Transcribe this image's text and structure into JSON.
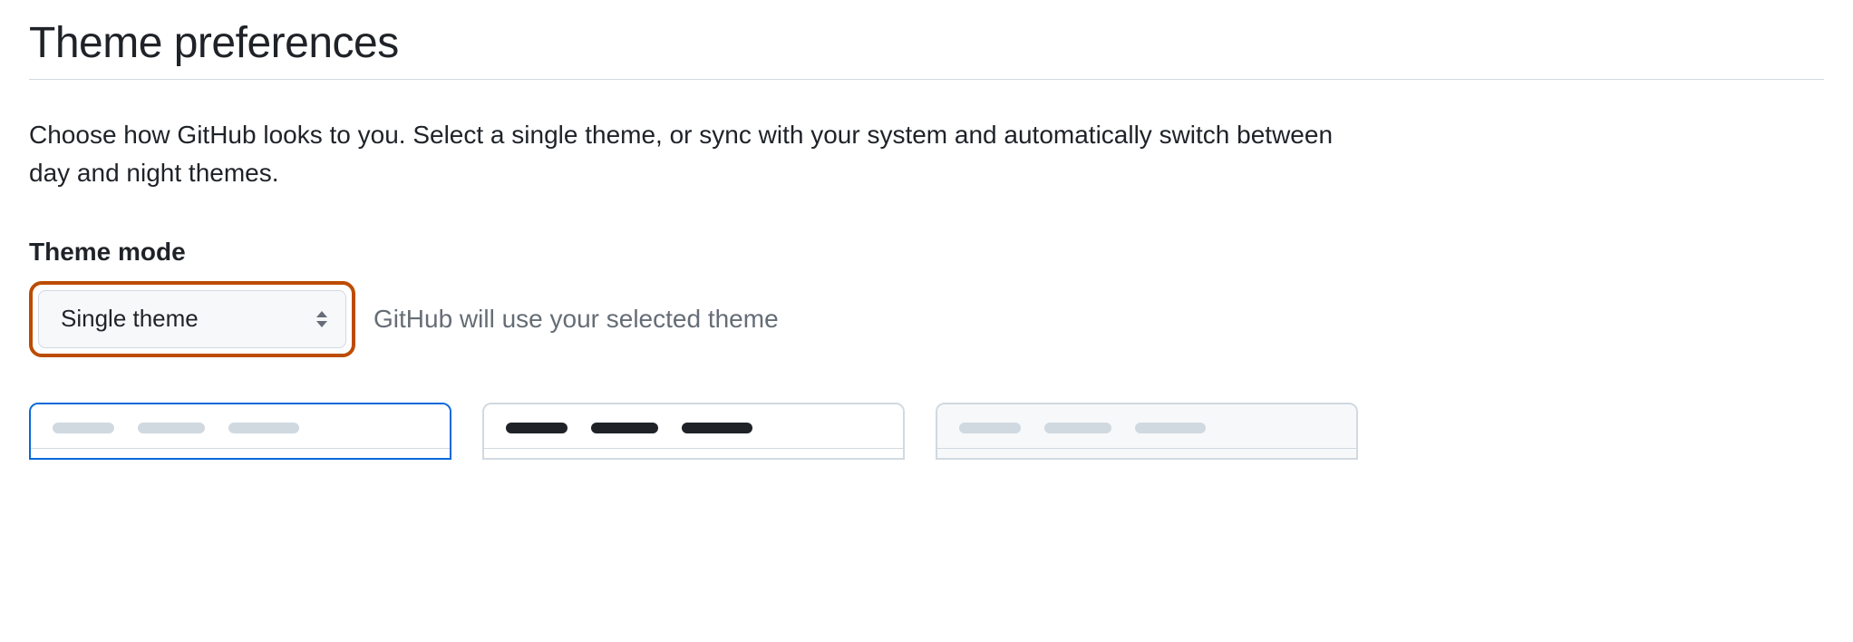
{
  "page": {
    "title": "Theme preferences",
    "description": "Choose how GitHub looks to you. Select a single theme, or sync with your system and automatically switch between day and night themes."
  },
  "theme_mode": {
    "label": "Theme mode",
    "selected": "Single theme",
    "helper": "GitHub will use your selected theme"
  },
  "theme_cards": [
    {
      "id": "light-default",
      "selected": true,
      "pill_style": "light",
      "dimmed": false
    },
    {
      "id": "dark-default",
      "selected": false,
      "pill_style": "dark",
      "dimmed": false
    },
    {
      "id": "light-high-contrast",
      "selected": false,
      "pill_style": "light",
      "dimmed": true
    }
  ]
}
